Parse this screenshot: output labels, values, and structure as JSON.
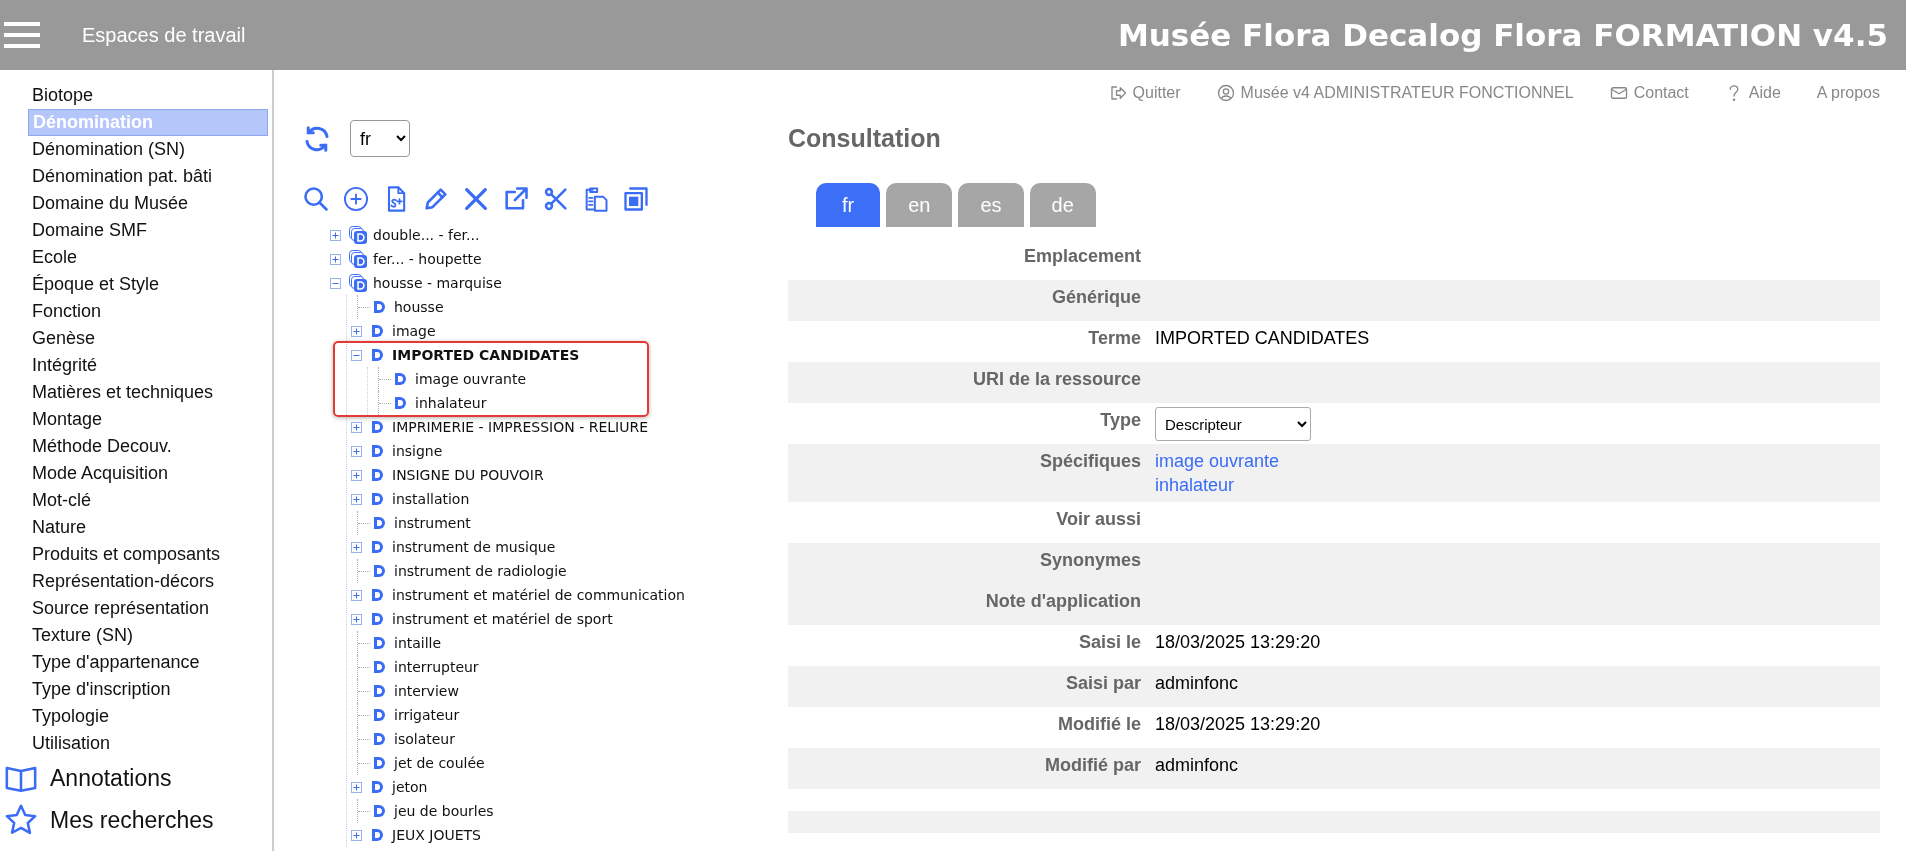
{
  "header": {
    "workspaces": "Espaces de travail",
    "title": "Musée Flora Decalog Flora FORMATION v4.5"
  },
  "sidebar": {
    "items": [
      {
        "label": "Biotope",
        "selected": false
      },
      {
        "label": "Dénomination",
        "selected": true
      },
      {
        "label": "Dénomination (SN)",
        "selected": false
      },
      {
        "label": "Dénomination pat. bâti",
        "selected": false
      },
      {
        "label": "Domaine du Musée",
        "selected": false
      },
      {
        "label": "Domaine SMF",
        "selected": false
      },
      {
        "label": "Ecole",
        "selected": false
      },
      {
        "label": "Époque et Style",
        "selected": false
      },
      {
        "label": "Fonction",
        "selected": false
      },
      {
        "label": "Genèse",
        "selected": false
      },
      {
        "label": "Intégrité",
        "selected": false
      },
      {
        "label": "Matières et techniques",
        "selected": false
      },
      {
        "label": "Montage",
        "selected": false
      },
      {
        "label": "Méthode Decouv.",
        "selected": false
      },
      {
        "label": "Mode Acquisition",
        "selected": false
      },
      {
        "label": "Mot-clé",
        "selected": false
      },
      {
        "label": "Nature",
        "selected": false
      },
      {
        "label": "Produits et composants",
        "selected": false
      },
      {
        "label": "Représentation-décors",
        "selected": false
      },
      {
        "label": "Source représentation",
        "selected": false
      },
      {
        "label": "Texture (SN)",
        "selected": false
      },
      {
        "label": "Type d'appartenance",
        "selected": false
      },
      {
        "label": "Type d'inscription",
        "selected": false
      },
      {
        "label": "Typologie",
        "selected": false
      },
      {
        "label": "Utilisation",
        "selected": false
      }
    ],
    "sections": [
      {
        "label": "Annotations",
        "kind": "book"
      },
      {
        "label": "Mes recherches",
        "kind": "star"
      }
    ]
  },
  "tree_panel": {
    "language": "fr",
    "toolbar": [
      {
        "kind": "search"
      },
      {
        "kind": "add"
      },
      {
        "kind": "doc"
      },
      {
        "kind": "edit"
      },
      {
        "kind": "delete"
      },
      {
        "kind": "open"
      },
      {
        "kind": "cut"
      },
      {
        "kind": "paste"
      },
      {
        "kind": "copy"
      }
    ],
    "nodes": [
      {
        "label": "double... - fer...",
        "kind": "group",
        "expanded": false,
        "selected": false
      },
      {
        "label": "fer... - houpette",
        "kind": "group",
        "expanded": false,
        "selected": false
      },
      {
        "label": "housse - marquise",
        "kind": "group",
        "expanded": true,
        "selected": false,
        "children": [
          {
            "label": "housse",
            "kind": "term",
            "selected": false
          },
          {
            "label": "image",
            "kind": "term",
            "expanded": false,
            "selected": false
          },
          {
            "label": "IMPORTED CANDIDATES",
            "kind": "term",
            "expanded": true,
            "selected": true,
            "children": [
              {
                "label": "image ouvrante",
                "kind": "term",
                "selected": false
              },
              {
                "label": "inhalateur",
                "kind": "term",
                "selected": false
              }
            ]
          },
          {
            "label": "IMPRIMERIE - IMPRESSION - RELIURE",
            "kind": "term",
            "expanded": false,
            "selected": false
          },
          {
            "label": "insigne",
            "kind": "term",
            "expanded": false,
            "selected": false
          },
          {
            "label": "INSIGNE DU POUVOIR",
            "kind": "term",
            "expanded": false,
            "selected": false
          },
          {
            "label": "installation",
            "kind": "term",
            "expanded": false,
            "selected": false
          },
          {
            "label": "instrument",
            "kind": "term",
            "selected": false
          },
          {
            "label": "instrument de musique",
            "kind": "term",
            "expanded": false,
            "selected": false
          },
          {
            "label": "instrument de radiologie",
            "kind": "term",
            "selected": false
          },
          {
            "label": "instrument et matériel de communication",
            "kind": "term",
            "expanded": false,
            "selected": false
          },
          {
            "label": "instrument et matériel de sport",
            "kind": "term",
            "expanded": false,
            "selected": false
          },
          {
            "label": "intaille",
            "kind": "term",
            "selected": false
          },
          {
            "label": "interrupteur",
            "kind": "term",
            "selected": false
          },
          {
            "label": "interview",
            "kind": "term",
            "selected": false
          },
          {
            "label": "irrigateur",
            "kind": "term",
            "selected": false
          },
          {
            "label": "isolateur",
            "kind": "term",
            "selected": false
          },
          {
            "label": "jet de coulée",
            "kind": "term",
            "selected": false
          },
          {
            "label": "jeton",
            "kind": "term",
            "expanded": false,
            "selected": false
          },
          {
            "label": "jeu de bourles",
            "kind": "term",
            "selected": false
          },
          {
            "label": "JEUX JOUETS",
            "kind": "term",
            "expanded": false,
            "selected": false
          }
        ]
      }
    ]
  },
  "top_links": [
    {
      "label": "Quitter",
      "kind": "logout"
    },
    {
      "label": "Musée v4 ADMINISTRATEUR FONCTIONNEL",
      "kind": "user"
    },
    {
      "label": "Contact",
      "kind": "mail"
    },
    {
      "label": "Aide",
      "kind": "help"
    },
    {
      "label": "A propos",
      "kind": "none"
    }
  ],
  "consultation": {
    "title": "Consultation",
    "tabs": [
      {
        "label": "fr",
        "selected": true
      },
      {
        "label": "en",
        "selected": false
      },
      {
        "label": "es",
        "selected": false
      },
      {
        "label": "de",
        "selected": false
      }
    ],
    "fields": [
      {
        "label": "Emplacement",
        "shaded": false,
        "kind": "text"
      },
      {
        "label": "Générique",
        "shaded": true,
        "kind": "text"
      },
      {
        "label": "Terme",
        "shaded": false,
        "kind": "text",
        "value": "IMPORTED CANDIDATES"
      },
      {
        "label": "URI de la ressource",
        "shaded": true,
        "kind": "text"
      },
      {
        "label": "Type",
        "shaded": false,
        "kind": "select",
        "value": "Descripteur"
      },
      {
        "label": "Spécifiques",
        "shaded": true,
        "kind": "links",
        "links": [
          "image ouvrante",
          "inhalateur"
        ]
      },
      {
        "label": "Voir aussi",
        "shaded": false,
        "kind": "text"
      },
      {
        "label": "Synonymes",
        "shaded": true,
        "kind": "text"
      },
      {
        "label": "Note d'application",
        "shaded": true,
        "kind": "text"
      },
      {
        "label": "Saisi le",
        "shaded": false,
        "kind": "text",
        "value": "18/03/2025 13:29:20"
      },
      {
        "label": "Saisi par",
        "shaded": true,
        "kind": "text",
        "value": "adminfonc"
      },
      {
        "label": "Modifié le",
        "shaded": false,
        "kind": "text",
        "value": "18/03/2025 13:29:20"
      },
      {
        "label": "Modifié par",
        "shaded": true,
        "kind": "text",
        "value": "adminfonc"
      }
    ]
  }
}
